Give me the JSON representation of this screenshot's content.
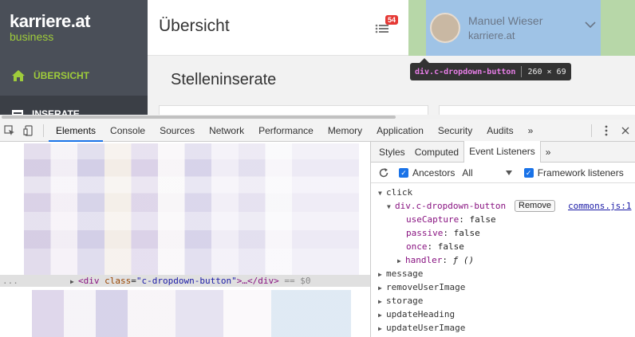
{
  "app": {
    "brand": {
      "logo": "karriere.at",
      "sub": "business"
    },
    "nav": [
      {
        "label": "ÜBERSICHT",
        "icon": "home-icon"
      },
      {
        "label": "INSERATE",
        "icon": "list-icon"
      }
    ],
    "header": {
      "title": "Übersicht",
      "notifications_count": "54",
      "user_name": "Manuel Wieser",
      "user_company": "karriere.at"
    },
    "content_title": "Stelleninserate",
    "tooltip": {
      "selector": "div.c-dropdown-button",
      "size": "260 × 69"
    }
  },
  "devtools": {
    "tabs": [
      "Elements",
      "Console",
      "Sources",
      "Network",
      "Performance",
      "Memory",
      "Application",
      "Security",
      "Audits",
      "»"
    ],
    "active_tab": "Elements",
    "selected_node": {
      "dots": "...",
      "tag_open": "<div",
      "attr_name": "class",
      "attr_value": "\"c-dropdown-button\"",
      "tag_rest": ">…</div>",
      "eq": " == $0"
    },
    "sidebar": {
      "tabs": [
        "Styles",
        "Computed",
        "Event Listeners",
        "»"
      ],
      "ancestors_label": "Ancestors",
      "ancestors_value": "All",
      "framework_label": "Framework listeners",
      "listeners": [
        "click",
        "message",
        "removeUserImage",
        "storage",
        "updateHeading",
        "updateUserImage"
      ],
      "click_entry": {
        "node": "div.c-dropdown-button",
        "remove_label": "Remove",
        "source": "commons.js:1",
        "props": [
          {
            "key": "useCapture",
            "value": "false"
          },
          {
            "key": "passive",
            "value": "false"
          },
          {
            "key": "once",
            "value": "false"
          }
        ],
        "handler_key": "handler",
        "handler_value": "ƒ ()"
      }
    }
  },
  "colors": {
    "accent_green": "#9fcc3b",
    "highlight_blue": "#9fc3e6",
    "margin_green": "#b7d7a8",
    "badge_red": "#e53935"
  }
}
